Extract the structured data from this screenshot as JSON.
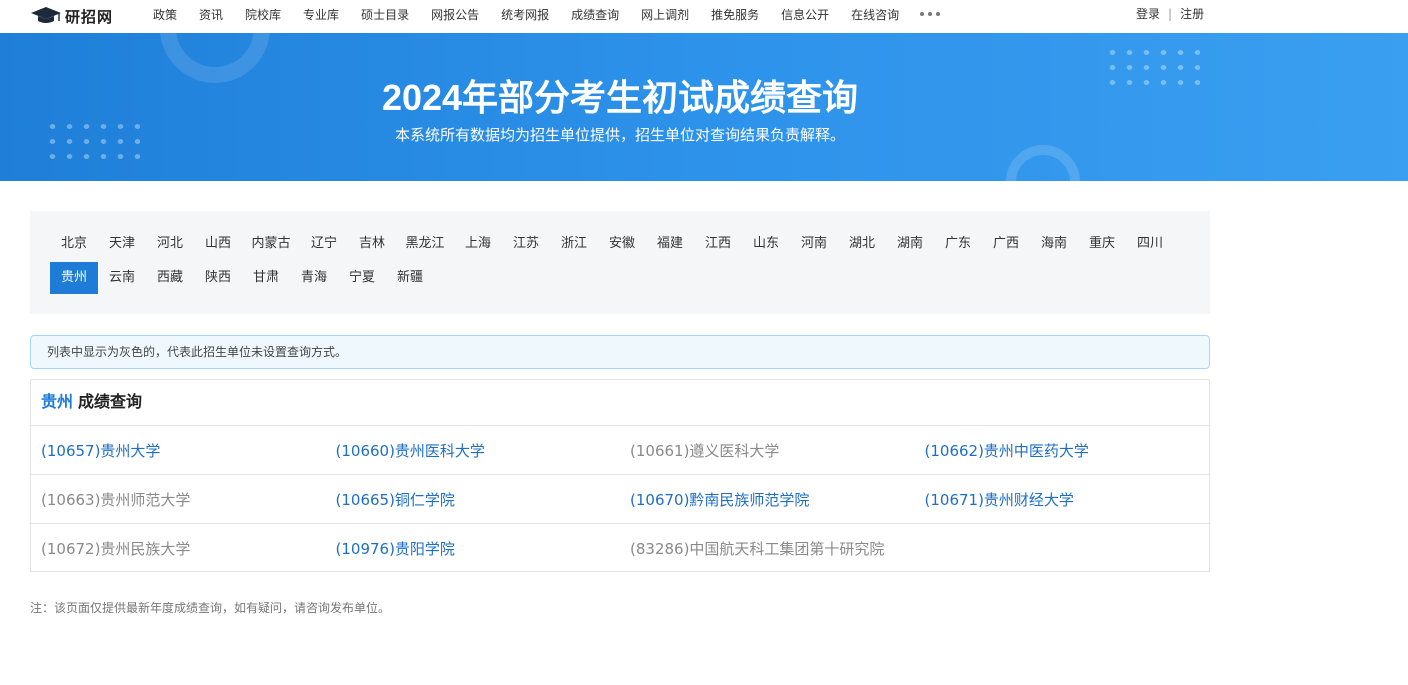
{
  "nav": {
    "logo_text": "研招网",
    "items": [
      "政策",
      "资讯",
      "院校库",
      "专业库",
      "硕士目录",
      "网报公告",
      "统考网报",
      "成绩查询",
      "网上调剂",
      "推免服务",
      "信息公开",
      "在线咨询"
    ],
    "more_icon": "more-dots-icon",
    "login": "登录",
    "separator": "|",
    "register": "注册"
  },
  "banner": {
    "title": "2024年部分考生初试成绩查询",
    "subtitle": "本系统所有数据均为招生单位提供，招生单位对查询结果负责解释。"
  },
  "provinces": {
    "row1": [
      "北京",
      "天津",
      "河北",
      "山西",
      "内蒙古",
      "辽宁",
      "吉林",
      "黑龙江",
      "上海",
      "江苏",
      "浙江",
      "安徽",
      "福建",
      "江西",
      "山东",
      "河南",
      "湖北",
      "湖南",
      "广东",
      "广西",
      "海南",
      "重庆",
      "四川"
    ],
    "row2": [
      "贵州",
      "云南",
      "西藏",
      "陕西",
      "甘肃",
      "青海",
      "宁夏",
      "新疆"
    ],
    "active": "贵州",
    "active_color": "#1e7cd7"
  },
  "notice": "列表中显示为灰色的，代表此招生单位未设置查询方式。",
  "results": {
    "province": "贵州",
    "heading": "成绩查询",
    "rows": [
      [
        {
          "text": "(10657)贵州大学",
          "available": true
        },
        {
          "text": "(10660)贵州医科大学",
          "available": true
        },
        {
          "text": "(10661)遵义医科大学",
          "available": false
        },
        {
          "text": "(10662)贵州中医药大学",
          "available": true
        }
      ],
      [
        {
          "text": "(10663)贵州师范大学",
          "available": false
        },
        {
          "text": "(10665)铜仁学院",
          "available": true
        },
        {
          "text": "(10670)黔南民族师范学院",
          "available": true
        },
        {
          "text": "(10671)贵州财经大学",
          "available": true
        }
      ],
      [
        {
          "text": "(10672)贵州民族大学",
          "available": false
        },
        {
          "text": "(10976)贵阳学院",
          "available": true
        },
        {
          "text": "(83286)中国航天科工集团第十研究院",
          "available": false
        },
        {
          "text": "",
          "available": false
        }
      ]
    ]
  },
  "footnote": "注：该页面仅提供最新年度成绩查询，如有疑问，请咨询发布单位。",
  "colors": {
    "link": "#1e6fc4",
    "unavailable": "#8a8a8a",
    "banner": "#2d92ea"
  }
}
